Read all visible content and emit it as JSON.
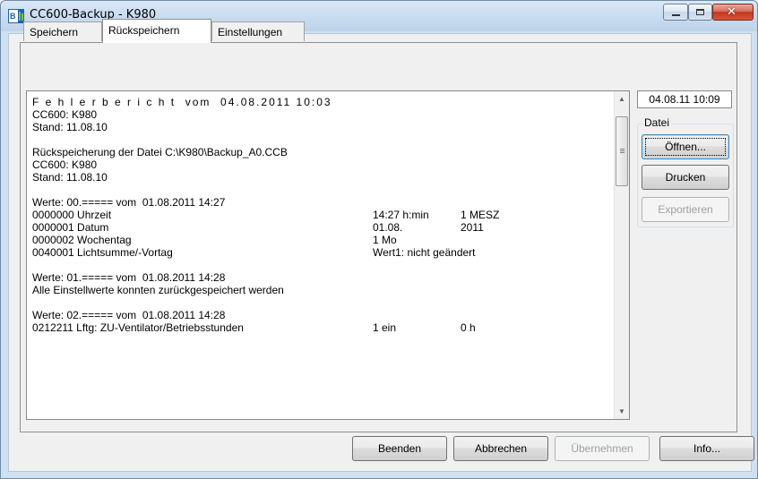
{
  "window": {
    "title": "CC600-Backup - K980",
    "icon_text": "BU"
  },
  "tabs": [
    {
      "label": "Speichern",
      "selected": false
    },
    {
      "label": "Rückspeichern",
      "selected": true
    },
    {
      "label": "Einstellungen",
      "selected": false
    }
  ],
  "report": {
    "lines": [
      "F e h l e r b e r i c h t  vom  04.08.2011 10:03",
      "CC600: K980",
      "Stand: 11.08.10",
      "",
      "Rückspeicherung der Datei C:\\K980\\Backup_A0.CCB",
      "CC600: K980",
      "Stand: 11.08.10",
      "",
      "Werte: 00.===== vom  01.08.2011 14:27",
      "0000000 Uhrzeit",
      "0000001 Datum",
      "0000002 Wochentag",
      "0040001 Lichtsumme/-Vortag",
      "",
      "Werte: 01.===== vom  01.08.2011 14:28",
      "Alle Einstellwerte konnten zurückgespeichert werden",
      "",
      "Werte: 02.===== vom  01.08.2011 14:28",
      "0212211 Lftg: ZU-Ventilator/Betriebsstunden"
    ],
    "values_col1": [
      {
        "row": 9,
        "text": "14:27 h:min"
      },
      {
        "row": 10,
        "text": "01.08."
      },
      {
        "row": 11,
        "text": "1 Mo"
      },
      {
        "row": 12,
        "text": "Wert1: nicht geändert"
      },
      {
        "row": 18,
        "text": "1 ein"
      }
    ],
    "values_col2": [
      {
        "row": 9,
        "text": "1 MESZ"
      },
      {
        "row": 10,
        "text": "2011"
      },
      {
        "row": 18,
        "text": "0 h"
      }
    ]
  },
  "side": {
    "date": "04.08.11 10:09",
    "group_label": "Datei",
    "open_label": "Öffnen...",
    "print_label": "Drucken",
    "export_label": "Exportieren"
  },
  "footer": {
    "exit_label": "Beenden",
    "cancel_label": "Abbrechen",
    "apply_label": "Übernehmen",
    "info_label": "Info..."
  }
}
